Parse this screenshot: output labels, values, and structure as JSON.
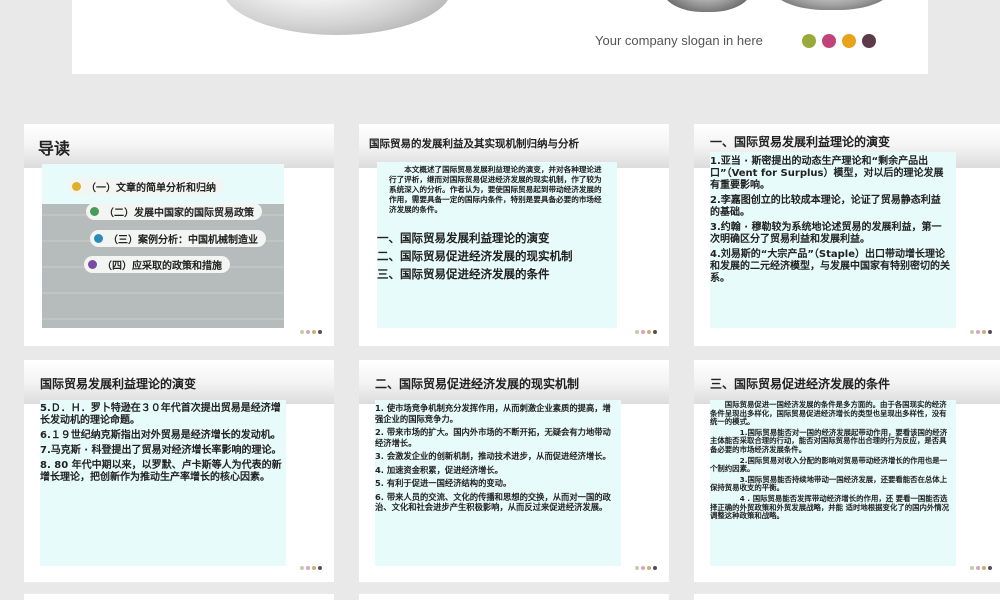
{
  "top_slide": {
    "slogan": "Your company slogan in here",
    "dot_colors": [
      "#9aaa3a",
      "#c0437a",
      "#e8a21c",
      "#5d3a4a"
    ]
  },
  "slides": [
    {
      "title": "导读",
      "items": [
        "（一）文章的简单分析和归纳",
        "（二）发展中国家的国际贸易政策",
        "（三）案例分析：中国机械制造业",
        "（四）应采取的政策和措施"
      ]
    },
    {
      "title": "国际贸易的发展利益及其实现机制归纳与分析",
      "intro": "本文概述了国际贸易发展利益理论的演变，并对各种理论进行了评析，继而对国际贸易促进经济发展的现实机制，作了较为系统深入的分析。作者认为，要使国际贸易起到带动经济发展的作用，需要具备一定的国际内条件，特别是要具备必要的市场经济发展的条件。",
      "items": [
        "一、国际贸易发展利益理论的演变",
        "二、国际贸易促进经济发展的现实机制",
        "三、国际贸易促进经济发展的条件"
      ]
    },
    {
      "title": "一、国际贸易发展利益理论的演变",
      "items": [
        "1.亚当 · 斯密提出的动态生产理论和“剩余产品出口”（Vent for Surplus）模型，对以后的理论发展有重要影响。",
        "2.李嘉图创立的比较成本理论，论证了贸易静态利益的基础。",
        "3.约翰 · 穆勒较为系统地论述贸易的发展利益，第一次明确区分了贸易利益和发展利益。",
        "4.刘易斯的“大宗产品”（Staple）出口带动增长理论和发展的二元经济模型，与发展中国家有特别密切的关系。"
      ]
    },
    {
      "title": "国际贸易发展利益理论的演变",
      "items": [
        "5.Ｄ．Ｈ．罗卜特逊在３０年代首次提出贸易是经济增长发动机的理论命题。",
        "6.１９世纪纳克斯指出对外贸易是经济增长的发动机。",
        "7.马克斯 · 科登提出了贸易对经济增长率影响的理论。",
        "8. 80 年代中期以来，以罗默、卢卡斯等人为代表的新增长理论，把创新作为推动生产率增长的核心因素。"
      ]
    },
    {
      "title": "二、国际贸易促进经济发展的现实机制",
      "items": [
        "1.  使市场竞争机制充分发挥作用，从而刺激企业素质的提高，增强企业的国际竞争力。",
        "2.  带来市场的扩大。国内外市场的不断开拓，无疑会有力地带动经济增长。",
        "3.  会激发企业的创新机制，推动技术进步，从而促进经济增长。",
        "4.  加速资金积累，促进经济增长。",
        "5.  有利于促进一国经济结构的变动。",
        "6.  带来人员的交流、文化的传播和思想的交换，从而对一国的政治、文化和社会进步产生积极影响，从而反过来促进经济发展。"
      ]
    },
    {
      "title": "三、国际贸易促进经济发展的条件",
      "paras": [
        "国际贸易促进一国经济发展的条件是多方面的。由于各国现实的经济条件呈现出多样化，国际贸易促进经济增长的类型也呈现出多样性，没有统一的模式。",
        "1.国际贸易能否对一国的经济发展起带动作用，要看该国的经济主体能否采取合理的行动，能否对国际贸易作出合理的行为反应，是否具备必要的市场经济发展条件。",
        "2.国际贸易对收入分配的影响对贸易带动经济增长的作用也是一个制约因素。",
        "3.国际贸易能否持续地带动一国经济发展，还要看能否在总体上保持贸易收支的平衡。",
        "4 . 国际贸易能否发挥带动经济增长的作用，还 要看一国能否选择正确的外贸政策和外贸发展战略，并能 适时地根据变化了的国内外情况调整这种政策和战略。"
      ]
    }
  ],
  "mini_dot_colors": [
    "#c9c9a6",
    "#d9a6b9",
    "#c9b07a",
    "#5d4a55"
  ]
}
